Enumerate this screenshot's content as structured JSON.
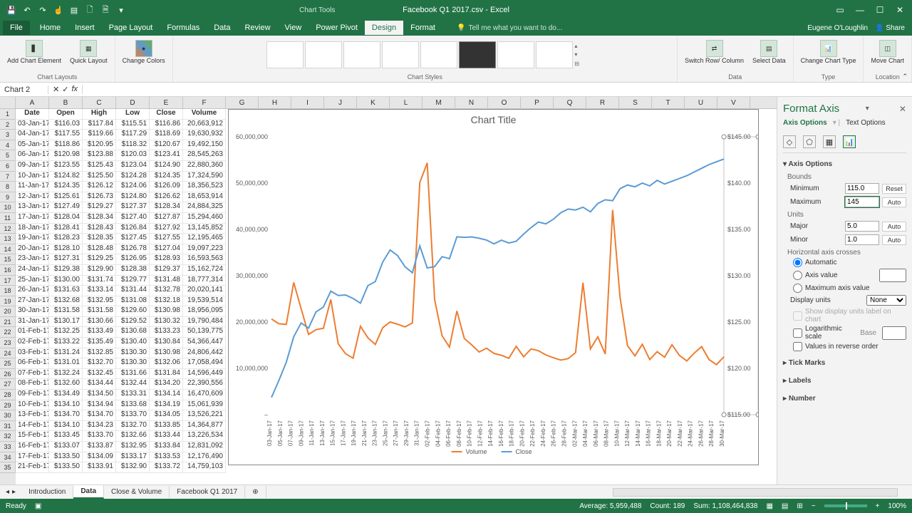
{
  "window": {
    "title": "Facebook Q1 2017.csv - Excel",
    "chart_tools": "Chart Tools",
    "account": "Eugene O'Loughlin",
    "share": "Share"
  },
  "ribbon_tabs": [
    "File",
    "Home",
    "Insert",
    "Page Layout",
    "Formulas",
    "Data",
    "Review",
    "View",
    "Power Pivot",
    "Design",
    "Format"
  ],
  "active_tab": "Design",
  "tell_me": "Tell me what you want to do...",
  "ribbon": {
    "add_element": "Add Chart Element",
    "quick_layout": "Quick Layout",
    "change_colors": "Change Colors",
    "chart_layouts": "Chart Layouts",
    "chart_styles": "Chart Styles",
    "switch": "Switch Row/ Column",
    "select_data": "Select Data",
    "data_group": "Data",
    "change_type": "Change Chart Type",
    "type_group": "Type",
    "move_chart": "Move Chart",
    "location": "Location"
  },
  "name_box": "Chart 2",
  "columns": [
    "A",
    "B",
    "C",
    "D",
    "E",
    "F",
    "G",
    "H",
    "I",
    "J",
    "K",
    "L",
    "M",
    "N",
    "O",
    "P",
    "Q",
    "R",
    "S",
    "T",
    "U",
    "V"
  ],
  "column_headers": {
    "A": "Date",
    "B": "Open",
    "C": "High",
    "D": "Low",
    "E": "Close",
    "F": "Volume"
  },
  "data": [
    [
      "03-Jan-17",
      "$116.03",
      "$117.84",
      "$115.51",
      "$116.86",
      "20,663,912"
    ],
    [
      "04-Jan-17",
      "$117.55",
      "$119.66",
      "$117.29",
      "$118.69",
      "19,630,932"
    ],
    [
      "05-Jan-17",
      "$118.86",
      "$120.95",
      "$118.32",
      "$120.67",
      "19,492,150"
    ],
    [
      "06-Jan-17",
      "$120.98",
      "$123.88",
      "$120.03",
      "$123.41",
      "28,545,263"
    ],
    [
      "09-Jan-17",
      "$123.55",
      "$125.43",
      "$123.04",
      "$124.90",
      "22,880,360"
    ],
    [
      "10-Jan-17",
      "$124.82",
      "$125.50",
      "$124.28",
      "$124.35",
      "17,324,590"
    ],
    [
      "11-Jan-17",
      "$124.35",
      "$126.12",
      "$124.06",
      "$126.09",
      "18,356,523"
    ],
    [
      "12-Jan-17",
      "$125.61",
      "$126.73",
      "$124.80",
      "$126.62",
      "18,653,914"
    ],
    [
      "13-Jan-17",
      "$127.49",
      "$129.27",
      "$127.37",
      "$128.34",
      "24,884,325"
    ],
    [
      "17-Jan-17",
      "$128.04",
      "$128.34",
      "$127.40",
      "$127.87",
      "15,294,460"
    ],
    [
      "18-Jan-17",
      "$128.41",
      "$128.43",
      "$126.84",
      "$127.92",
      "13,145,852"
    ],
    [
      "19-Jan-17",
      "$128.23",
      "$128.35",
      "$127.45",
      "$127.55",
      "12,195,465"
    ],
    [
      "20-Jan-17",
      "$128.10",
      "$128.48",
      "$126.78",
      "$127.04",
      "19,097,223"
    ],
    [
      "23-Jan-17",
      "$127.31",
      "$129.25",
      "$126.95",
      "$128.93",
      "16,593,563"
    ],
    [
      "24-Jan-17",
      "$129.38",
      "$129.90",
      "$128.38",
      "$129.37",
      "15,162,724"
    ],
    [
      "25-Jan-17",
      "$130.00",
      "$131.74",
      "$129.77",
      "$131.48",
      "18,777,314"
    ],
    [
      "26-Jan-17",
      "$131.63",
      "$133.14",
      "$131.44",
      "$132.78",
      "20,020,141"
    ],
    [
      "27-Jan-17",
      "$132.68",
      "$132.95",
      "$131.08",
      "$132.18",
      "19,539,514"
    ],
    [
      "30-Jan-17",
      "$131.58",
      "$131.58",
      "$129.60",
      "$130.98",
      "18,956,095"
    ],
    [
      "31-Jan-17",
      "$130.17",
      "$130.66",
      "$129.52",
      "$130.32",
      "19,790,484"
    ],
    [
      "01-Feb-17",
      "$132.25",
      "$133.49",
      "$130.68",
      "$133.23",
      "50,139,775"
    ],
    [
      "02-Feb-17",
      "$133.22",
      "$135.49",
      "$130.40",
      "$130.84",
      "54,366,447"
    ],
    [
      "03-Feb-17",
      "$131.24",
      "$132.85",
      "$130.30",
      "$130.98",
      "24,806,442"
    ],
    [
      "06-Feb-17",
      "$131.01",
      "$132.70",
      "$130.30",
      "$132.06",
      "17,058,494"
    ],
    [
      "07-Feb-17",
      "$132.24",
      "$132.45",
      "$131.66",
      "$131.84",
      "14,596,449"
    ],
    [
      "08-Feb-17",
      "$132.60",
      "$134.44",
      "$132.44",
      "$134.20",
      "22,390,556"
    ],
    [
      "09-Feb-17",
      "$134.49",
      "$134.50",
      "$133.31",
      "$134.14",
      "16,470,609"
    ],
    [
      "10-Feb-17",
      "$134.10",
      "$134.94",
      "$133.68",
      "$134.19",
      "15,061,939"
    ],
    [
      "13-Feb-17",
      "$134.70",
      "$134.70",
      "$133.70",
      "$134.05",
      "13,526,221"
    ],
    [
      "14-Feb-17",
      "$134.10",
      "$134.23",
      "$132.70",
      "$133.85",
      "14,364,877"
    ],
    [
      "15-Feb-17",
      "$133.45",
      "$133.70",
      "$132.66",
      "$133.44",
      "13,226,534"
    ],
    [
      "16-Feb-17",
      "$133.07",
      "$133.87",
      "$132.95",
      "$133.84",
      "12,831,092"
    ],
    [
      "17-Feb-17",
      "$133.50",
      "$134.09",
      "$133.17",
      "$133.53",
      "12,176,490"
    ],
    [
      "21-Feb-17",
      "$133.50",
      "$133.91",
      "$132.90",
      "$133.72",
      "14,759,103"
    ]
  ],
  "chart_data": {
    "type": "line",
    "title": "Chart Title",
    "y1_label": "Volume",
    "y2_label": "Close",
    "y1_ticks": [
      0,
      10000000,
      20000000,
      30000000,
      40000000,
      50000000,
      60000000
    ],
    "y1_tick_labels": [
      "–",
      "10,000,000",
      "20,000,000",
      "30,000,000",
      "40,000,000",
      "50,000,000",
      "60,000,000"
    ],
    "y2_ticks": [
      115,
      120,
      125,
      130,
      135,
      140,
      145
    ],
    "y2_tick_labels": [
      "$115.00",
      "$120.00",
      "$125.00",
      "$130.00",
      "$135.00",
      "$140.00",
      "$145.00"
    ],
    "x_categories": [
      "03-Jan-17",
      "05-Jan-17",
      "07-Jan-17",
      "09-Jan-17",
      "11-Jan-17",
      "13-Jan-17",
      "15-Jan-17",
      "17-Jan-17",
      "19-Jan-17",
      "21-Jan-17",
      "23-Jan-17",
      "25-Jan-17",
      "27-Jan-17",
      "29-Jan-17",
      "31-Jan-17",
      "02-Feb-17",
      "04-Feb-17",
      "06-Feb-17",
      "08-Feb-17",
      "10-Feb-17",
      "12-Feb-17",
      "14-Feb-17",
      "16-Feb-17",
      "18-Feb-17",
      "20-Feb-17",
      "22-Feb-17",
      "24-Feb-17",
      "26-Feb-17",
      "28-Feb-17",
      "02-Mar-17",
      "04-Mar-17",
      "06-Mar-17",
      "08-Mar-17",
      "10-Mar-17",
      "12-Mar-17",
      "14-Mar-17",
      "16-Mar-17",
      "18-Mar-17",
      "20-Mar-17",
      "22-Mar-17",
      "24-Mar-17",
      "26-Mar-17",
      "28-Mar-17",
      "30-Mar-17"
    ],
    "series": [
      {
        "name": "Volume",
        "axis": "y1",
        "color": "#ed7d31",
        "values": [
          20663912,
          19630932,
          19492150,
          28545263,
          22880360,
          17324590,
          18356523,
          18653914,
          24884325,
          15294460,
          13145852,
          12195465,
          19097223,
          16593563,
          15162724,
          18777314,
          20020141,
          19539514,
          18956095,
          19790484,
          50139775,
          54366447,
          24806442,
          17058494,
          14596449,
          22390556,
          16470609,
          15061939,
          13526221,
          14364877,
          13226534,
          12831092,
          12176490,
          14759103,
          12500000,
          14200000,
          13800000,
          12900000,
          12300000,
          11800000,
          12100000,
          13400000,
          28500000,
          14200000,
          16800000,
          13100000,
          44200000,
          25300000,
          14900000,
          12700000,
          15200000,
          11900000,
          13600000,
          12400000,
          15100000,
          12800000,
          11600000,
          13300000,
          14700000,
          11900000,
          10800000,
          12500000
        ]
      },
      {
        "name": "Close",
        "axis": "y2",
        "color": "#5b9bd5",
        "values": [
          116.86,
          118.69,
          120.67,
          123.41,
          124.9,
          124.35,
          126.09,
          126.62,
          128.34,
          127.87,
          127.92,
          127.55,
          127.04,
          128.93,
          129.37,
          131.48,
          132.78,
          132.18,
          130.98,
          130.32,
          133.23,
          130.84,
          130.98,
          132.06,
          131.84,
          134.2,
          134.14,
          134.19,
          134.05,
          133.85,
          133.44,
          133.84,
          133.53,
          133.72,
          134.5,
          135.2,
          135.8,
          135.6,
          136.1,
          136.8,
          137.2,
          137.1,
          137.4,
          136.9,
          137.8,
          138.2,
          138.1,
          139.4,
          139.8,
          139.6,
          140.0,
          139.7,
          140.3,
          139.9,
          140.2,
          140.5,
          140.8,
          141.2,
          141.6,
          142.0,
          142.3,
          142.6
        ]
      }
    ],
    "legend": [
      "Volume",
      "Close"
    ]
  },
  "format_pane": {
    "title": "Format Axis",
    "tab1": "Axis Options",
    "tab2": "Text Options",
    "section": "Axis Options",
    "bounds": "Bounds",
    "min_label": "Minimum",
    "min_val": "115.0",
    "min_aux": "Reset",
    "max_label": "Maximum",
    "max_val": "145",
    "max_aux": "Auto",
    "units": "Units",
    "major_label": "Major",
    "major_val": "5.0",
    "major_aux": "Auto",
    "minor_label": "Minor",
    "minor_val": "1.0",
    "minor_aux": "Auto",
    "haxis": "Horizontal axis crosses",
    "opt_auto": "Automatic",
    "opt_value": "Axis value",
    "opt_maxval": "Maximum axis value",
    "display_units": "Display units",
    "display_sel": "None",
    "show_units": "Show display units label on chart",
    "log": "Logarithmic scale",
    "log_base": "Base",
    "reverse": "Values in reverse order",
    "tickmarks": "Tick Marks",
    "labels": "Labels",
    "number": "Number"
  },
  "sheet_tabs": [
    "Introduction",
    "Data",
    "Close & Volume",
    "Facebook Q1 2017"
  ],
  "active_sheet": "Data",
  "status": {
    "ready": "Ready",
    "average": "Average: 5,959,488",
    "count": "Count: 189",
    "sum": "Sum: 1,108,464,838",
    "zoom": "100%"
  }
}
